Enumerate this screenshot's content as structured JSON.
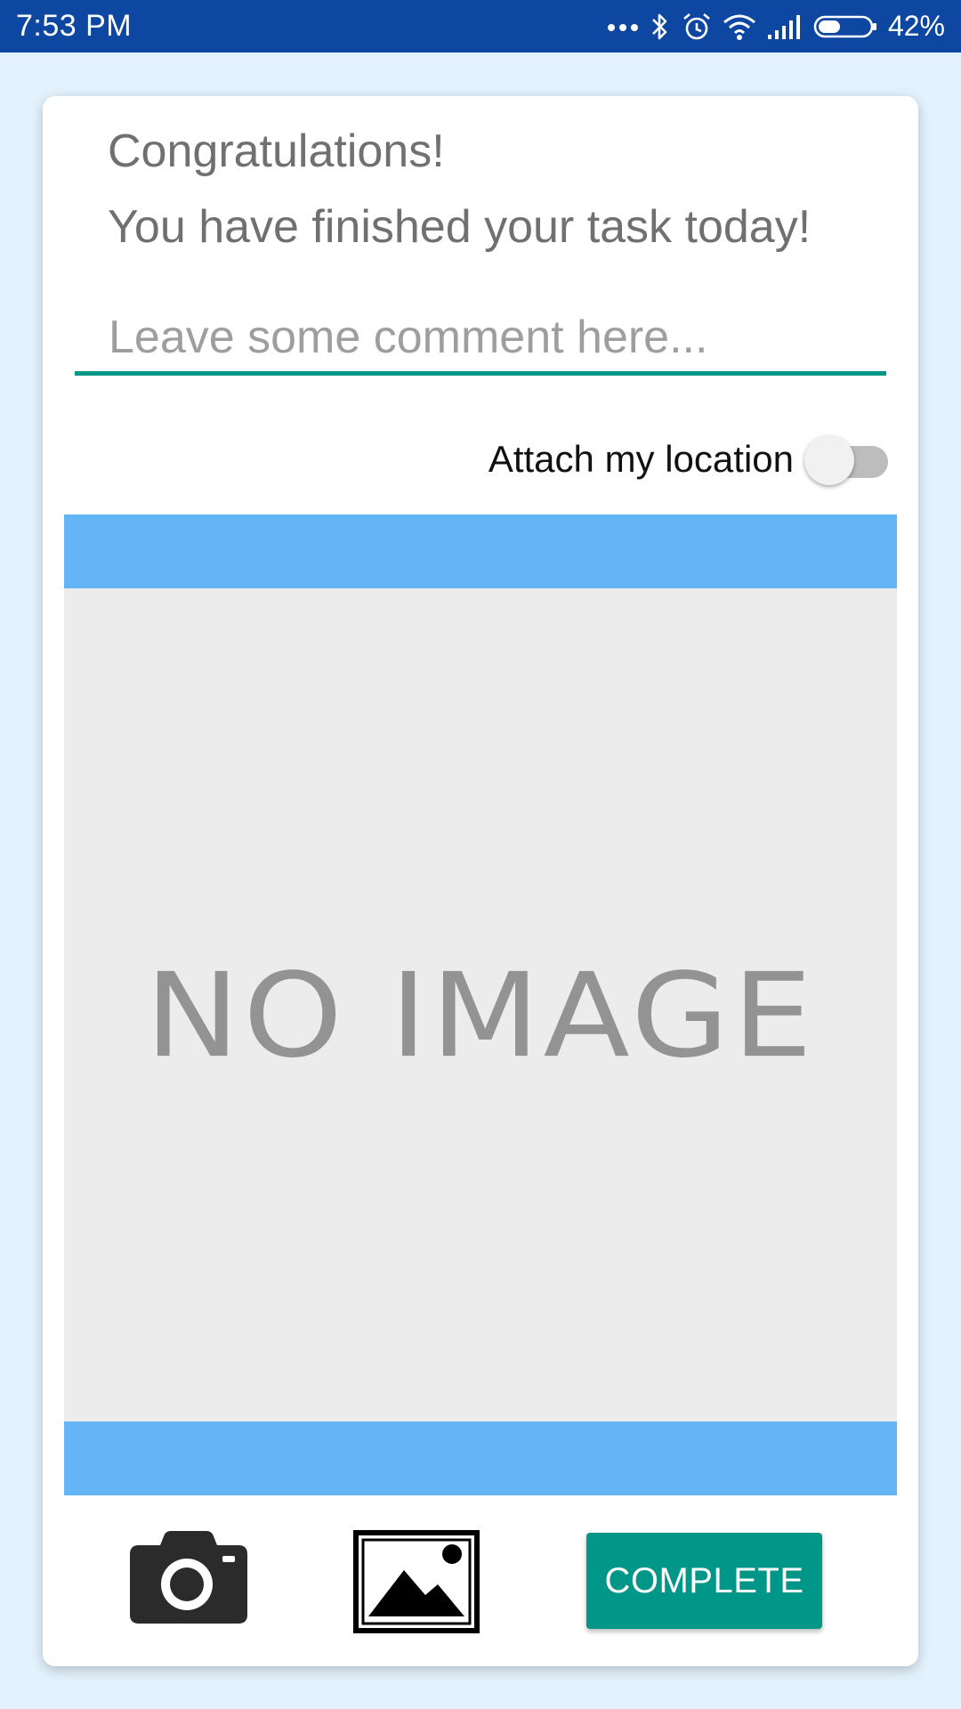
{
  "status_bar": {
    "time": "7:53  PM",
    "battery_percent": "42%",
    "battery_level": 0.42,
    "icons": [
      "more-dots-icon",
      "bluetooth-icon",
      "alarm-icon",
      "wifi-icon",
      "signal-icon",
      "battery-icon"
    ]
  },
  "card": {
    "congrats": "Congratulations!",
    "finished": "You have finished your task today!",
    "comment_placeholder": "Leave some comment here...",
    "comment_value": "",
    "location_label": "Attach my location",
    "location_enabled": false,
    "no_image_text": "NO IMAGE",
    "complete_label": "COMPLETE"
  },
  "colors": {
    "status_bar": "#0d47a1",
    "background": "#e3f2fd",
    "accent": "#009688",
    "image_bars": "#64b5f6",
    "placeholder_bg": "#ececec"
  }
}
